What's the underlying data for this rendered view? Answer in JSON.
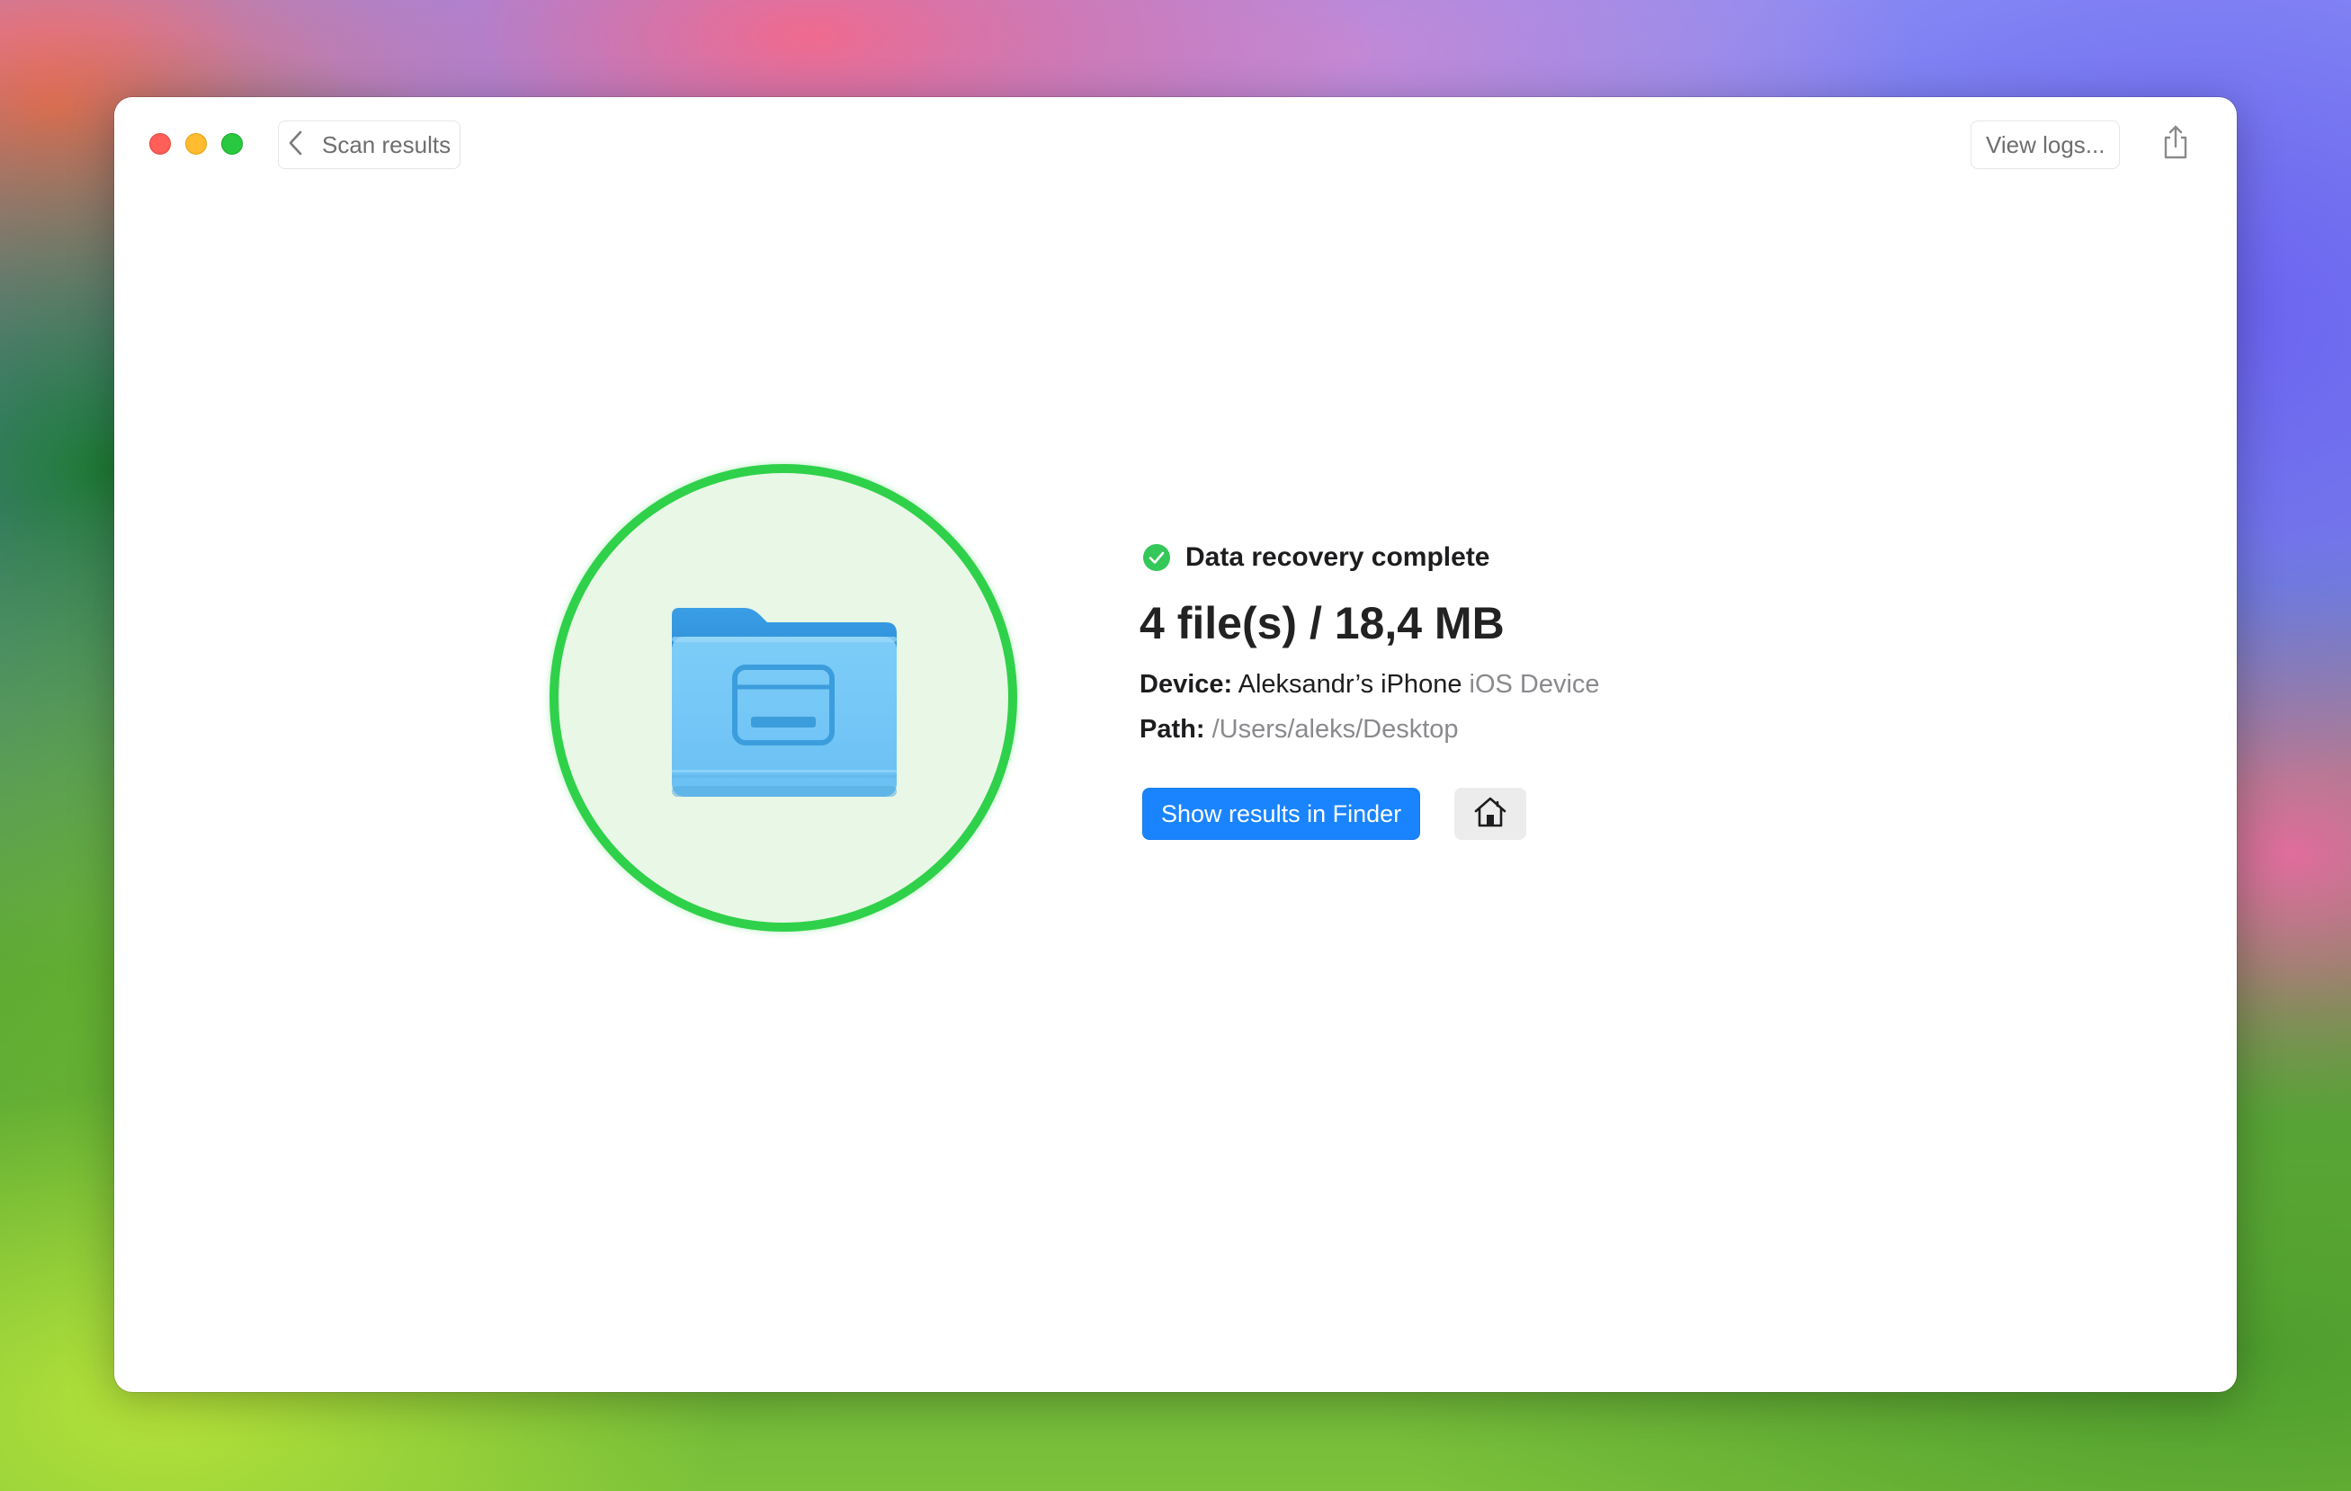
{
  "window": {
    "back_label": "Scan results",
    "view_logs_label": "View logs..."
  },
  "result": {
    "status": "Data recovery complete",
    "summary": "4 file(s) / 18,4 MB",
    "device_label": "Device:",
    "device_name": "Aleksandr’s iPhone",
    "device_type": "iOS Device",
    "path_label": "Path:",
    "path_value": "/Users/aleks/Desktop"
  },
  "actions": {
    "show_in_finder": "Show results in Finder"
  },
  "icons": {
    "back": "chevron-left-icon",
    "share": "share-icon",
    "status": "checkmark-circle-icon",
    "folder": "folder-icon",
    "home": "house-icon"
  },
  "colors": {
    "accent": "#1a84ff",
    "success": "#2fd14a",
    "folder": "#6cc3f7"
  }
}
